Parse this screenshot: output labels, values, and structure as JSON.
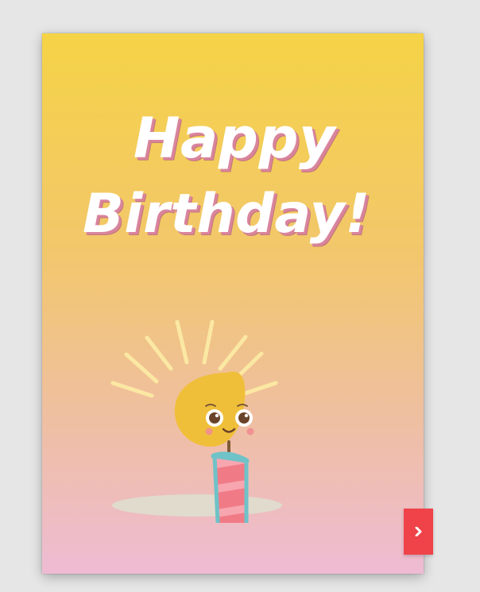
{
  "card": {
    "title_line_1": "Happy",
    "title_line_2": "Birthday!"
  },
  "illustration": {
    "name": "candle-illustration",
    "icon": "candle-icon",
    "colors": {
      "flame": "#f0bf39",
      "rays": "#fbe8a3",
      "candle_stripe": "#f07b86",
      "candle_edge": "#6fc2c8",
      "shadow": "#dedccc"
    }
  },
  "navigation": {
    "next_icon": "chevron-right-icon",
    "next_color": "#ef4349"
  }
}
